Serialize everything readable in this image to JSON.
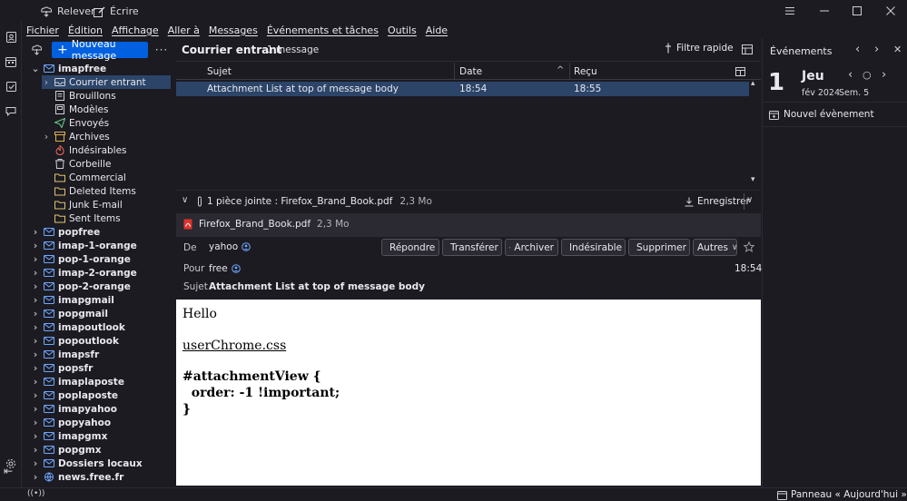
{
  "toolbar": {
    "get_messages": "Relever",
    "write": "Écrire"
  },
  "menu": [
    "Fichier",
    "Édition",
    "Affichage",
    "Aller à",
    "Messages",
    "Événements et tâches",
    "Outils",
    "Aide"
  ],
  "folder_pane": {
    "new_message": "Nouveau message",
    "accounts": [
      {
        "name": "imapfree",
        "expanded": true,
        "folders": [
          {
            "name": "Courrier entrant",
            "icon": "inbox-icon",
            "selected": true,
            "twisty": true
          },
          {
            "name": "Brouillons",
            "icon": "drafts-icon"
          },
          {
            "name": "Modèles",
            "icon": "templates-icon"
          },
          {
            "name": "Envoyés",
            "icon": "sent-icon"
          },
          {
            "name": "Archives",
            "icon": "archive-icon",
            "twisty": true
          },
          {
            "name": "Indésirables",
            "icon": "junk-icon"
          },
          {
            "name": "Corbeille",
            "icon": "trash-icon"
          },
          {
            "name": "Commercial",
            "icon": "folder-icon"
          },
          {
            "name": "Deleted Items",
            "icon": "folder-icon"
          },
          {
            "name": "Junk E-mail",
            "icon": "folder-icon"
          },
          {
            "name": "Sent Items",
            "icon": "folder-icon"
          }
        ]
      },
      {
        "name": "popfree"
      },
      {
        "name": "imap-1-orange"
      },
      {
        "name": "pop-1-orange"
      },
      {
        "name": "imap-2-orange"
      },
      {
        "name": "pop-2-orange"
      },
      {
        "name": "imapgmail"
      },
      {
        "name": "popgmail"
      },
      {
        "name": "imapoutlook"
      },
      {
        "name": "popoutlook"
      },
      {
        "name": "imapsfr"
      },
      {
        "name": "popsfr"
      },
      {
        "name": "imaplaposte"
      },
      {
        "name": "poplaposte"
      },
      {
        "name": "imapyahoo"
      },
      {
        "name": "popyahoo"
      },
      {
        "name": "imapgmx"
      },
      {
        "name": "popgmx"
      },
      {
        "name": "Dossiers locaux"
      },
      {
        "name": "news.free.fr",
        "globe": true
      }
    ]
  },
  "thread_pane": {
    "folder_title": "Courrier entrant",
    "count": "1 message",
    "quick_filter": "Filtre rapide",
    "columns": {
      "subject": "Sujet",
      "date": "Date",
      "received": "Reçu"
    },
    "messages": [
      {
        "subject": "Attachment List at top of message body",
        "date": "18:54",
        "received": "18:55"
      }
    ]
  },
  "message": {
    "attachment_summary": "1 pièce jointe : Firefox_Brand_Book.pdf",
    "attachment_size": "2,3 Mo",
    "save_label": "Enregistrer",
    "attachment_name": "Firefox_Brand_Book.pdf",
    "from_label": "De",
    "from": "yahoo",
    "to_label": "Pour",
    "to": "free",
    "subject_label": "Sujet",
    "subject": "Attachment List at top of message body",
    "time": "18:54",
    "buttons": {
      "reply": "Répondre",
      "forward": "Transférer",
      "archive": "Archiver",
      "junk": "Indésirable",
      "delete": "Supprimer",
      "more": "Autres"
    },
    "body": {
      "greeting": "Hello",
      "link": "userChrome.css",
      "code_1": "#attachmentView {",
      "code_2": "  order: -1 !important;",
      "code_3": "}"
    }
  },
  "today_pane": {
    "title": "Événements",
    "day_number": "1",
    "day_name": "Jeu",
    "month_year": "fév 2024",
    "week": "Sem. 5",
    "new_event": "Nouvel évènement"
  },
  "status_bar": {
    "today_pane_toggle": "Panneau « Aujourd'hui »"
  },
  "colors": {
    "accent": "#0060df",
    "selection": "#2b4468",
    "background": "#1c1b22"
  }
}
